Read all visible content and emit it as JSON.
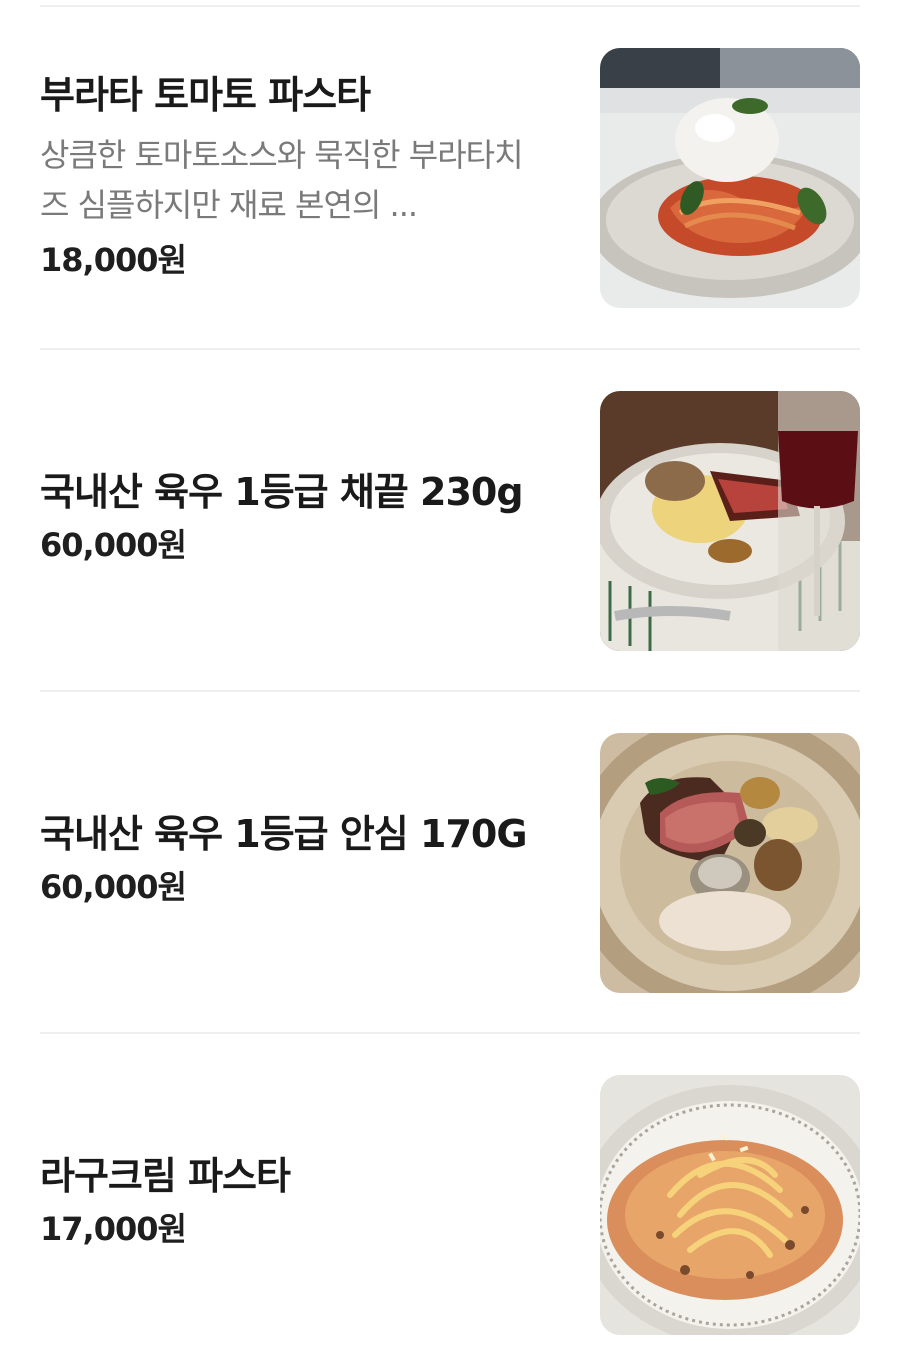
{
  "menu": {
    "items": [
      {
        "name": "부라타 토마토 파스타",
        "description": "상큼한 토마토소스와 묵직한 부라타치즈 심플하지만 재료 본연의 ...",
        "price": "18,000원",
        "photo_icon": "burrata-pasta-photo"
      },
      {
        "name": "국내산 육우 1등급 채끝 230g",
        "price": "60,000원",
        "photo_icon": "sirloin-steak-photo"
      },
      {
        "name": "국내산 육우 1등급 안심 170G",
        "price": "60,000원",
        "photo_icon": "tenderloin-steak-photo"
      },
      {
        "name": "라구크림 파스타",
        "price": "17,000원",
        "photo_icon": "ragu-cream-pasta-photo"
      }
    ]
  }
}
